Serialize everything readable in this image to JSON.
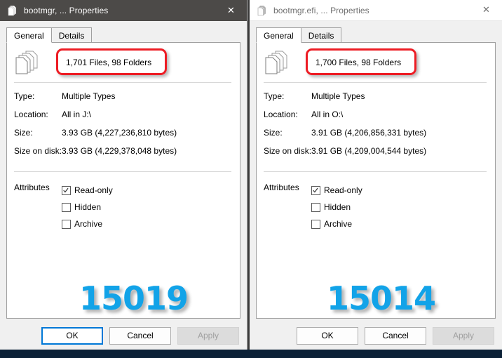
{
  "windows": [
    {
      "id": "left",
      "state": "active",
      "title": "bootmgr, ... Properties",
      "title_icon": "multi-document-icon",
      "close_icon": "close-icon",
      "tabs": [
        {
          "label": "General",
          "active": true
        },
        {
          "label": "Details",
          "active": false
        }
      ],
      "content_icon": "document-stack-icon",
      "file_count": "1,701 Files, 98 Folders",
      "info": [
        {
          "label": "Type:",
          "value": "Multiple Types"
        },
        {
          "label": "Location:",
          "value": "All in J:\\"
        },
        {
          "label": "Size:",
          "value": "3.93 GB (4,227,236,810 bytes)"
        },
        {
          "label": "Size on disk:",
          "value": "3.93 GB (4,229,378,048 bytes)"
        }
      ],
      "attributes_label": "Attributes",
      "attributes": [
        {
          "label": "Read-only",
          "checked": true
        },
        {
          "label": "Hidden",
          "checked": false
        },
        {
          "label": "Archive",
          "checked": false
        }
      ],
      "watermark": "15019",
      "buttons": [
        {
          "label": "OK",
          "style": "default-focus",
          "enabled": true
        },
        {
          "label": "Cancel",
          "style": "plain",
          "enabled": true
        },
        {
          "label": "Apply",
          "style": "disabled",
          "enabled": false
        }
      ]
    },
    {
      "id": "right",
      "state": "inactive",
      "title": "bootmgr.efi, ... Properties",
      "title_icon": "multi-document-icon",
      "close_icon": "close-icon",
      "tabs": [
        {
          "label": "General",
          "active": true
        },
        {
          "label": "Details",
          "active": false
        }
      ],
      "content_icon": "document-stack-icon",
      "file_count": "1,700 Files, 98 Folders",
      "info": [
        {
          "label": "Type:",
          "value": "Multiple Types"
        },
        {
          "label": "Location:",
          "value": "All in O:\\"
        },
        {
          "label": "Size:",
          "value": "3.91 GB (4,206,856,331 bytes)"
        },
        {
          "label": "Size on disk:",
          "value": "3.91 GB (4,209,004,544 bytes)"
        }
      ],
      "attributes_label": "Attributes",
      "attributes": [
        {
          "label": "Read-only",
          "checked": true
        },
        {
          "label": "Hidden",
          "checked": false
        },
        {
          "label": "Archive",
          "checked": false
        }
      ],
      "watermark": "15014",
      "buttons": [
        {
          "label": "OK",
          "style": "plain",
          "enabled": true
        },
        {
          "label": "Cancel",
          "style": "plain",
          "enabled": true
        },
        {
          "label": "Apply",
          "style": "disabled",
          "enabled": false
        }
      ]
    }
  ],
  "colors": {
    "annotation": "#ed1c24",
    "watermark": "#12a3e8",
    "active_titlebar": "#4c4a48",
    "focus_border": "#0078d7",
    "desktop_strip": "#0b2137"
  },
  "close_glyph": "✕"
}
